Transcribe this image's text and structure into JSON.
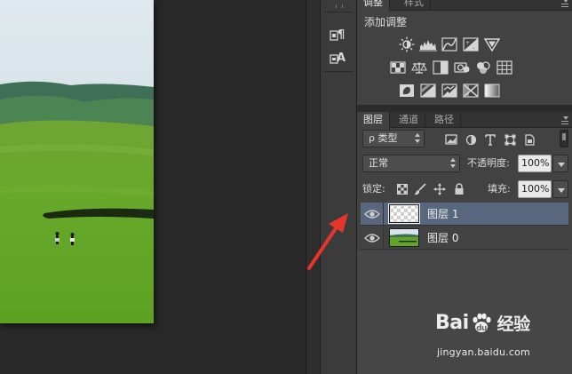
{
  "adjustments_panel": {
    "tabs": [
      {
        "label": "调整",
        "active": true
      },
      {
        "label": "样式",
        "active": false
      }
    ],
    "title": "添加调整",
    "icons_row1": [
      "brightness-contrast-icon",
      "levels-icon",
      "curves-icon",
      "exposure-icon",
      "vibrance-icon"
    ],
    "icons_row2": [
      "hue-saturation-icon",
      "color-balance-icon",
      "black-white-icon",
      "photo-filter-icon",
      "channel-mixer-icon",
      "color-lookup-icon"
    ],
    "icons_row3": [
      "invert-icon",
      "posterize-icon",
      "threshold-icon",
      "selective-color-icon",
      "gradient-map-icon"
    ]
  },
  "layers_panel": {
    "tabs": [
      {
        "label": "图层",
        "active": true
      },
      {
        "label": "通道",
        "active": false
      },
      {
        "label": "路径",
        "active": false
      }
    ],
    "filter": {
      "search_glyph": "ρ",
      "label": "类型"
    },
    "blend_mode": "正常",
    "opacity_label": "不透明度:",
    "opacity_value": "100%",
    "lock_label": "锁定:",
    "fill_label": "填充:",
    "fill_value": "100%",
    "layers": [
      {
        "name": "图层 1",
        "selected": true,
        "visible": true,
        "thumbnail": "transparent"
      },
      {
        "name": "图层 0",
        "selected": false,
        "visible": true,
        "thumbnail": "landscape"
      }
    ]
  },
  "toolstrip": {
    "tool1_glyph": "¶",
    "tool2_glyph": "A"
  },
  "watermark": {
    "logo_text_a": "Bai",
    "logo_text_b": "u",
    "logo_cn": "经验",
    "url": "jingyan.baidu.com"
  },
  "colors": {
    "accent_selected_layer": "#58677d",
    "annotation_arrow": "#e8352b",
    "panel_bg": "#424242"
  }
}
